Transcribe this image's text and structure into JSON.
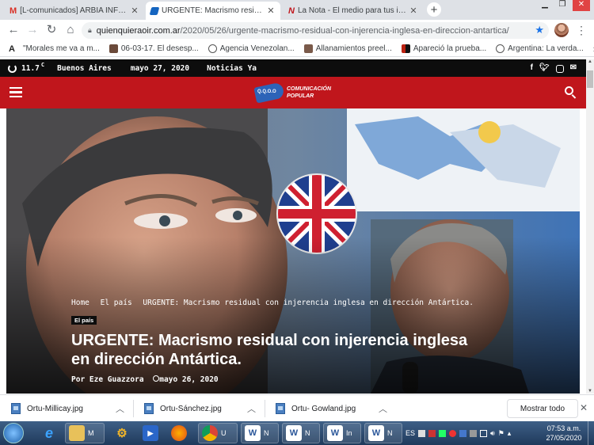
{
  "browser": {
    "tabs": [
      {
        "title": "[L-comunicados] ARBIA INFOR",
        "icon": "gmail-icon"
      },
      {
        "title": "URGENTE: Macrismo residual con",
        "icon": "site-icon",
        "active": true
      },
      {
        "title": "La Nota - El medio para tus ideas",
        "icon": "lanota-icon"
      }
    ],
    "new_tab": "+",
    "url_host": "quienquieraoir.com.ar",
    "url_path": "/2020/05/26/urgente-macrismo-residual-con-injerencia-inglesa-en-direccion-antartica/",
    "bookmarks": [
      {
        "label": "\"Morales me va a m...",
        "color": "#222"
      },
      {
        "label": "06-03-17. El desesp...",
        "color": "#6b4a3a"
      },
      {
        "label": "Agencia Venezolan...",
        "color": "#555"
      },
      {
        "label": "Allanamientos preel...",
        "color": "#7a5a4a"
      },
      {
        "label": "Apareció la prueba...",
        "color": "#b21"
      },
      {
        "label": "Argentina: La verda...",
        "color": "#555"
      }
    ],
    "bookmarks_more": "»"
  },
  "site": {
    "temperature": "11.7",
    "temp_unit": "C",
    "city": "Buenos Aires",
    "date": "mayo 27, 2020",
    "news_link": "Noticias Ya",
    "logo_text_1": "COMUNICACIÓN",
    "logo_text_2": "POPULAR",
    "logo_badge": "Q.Q.O.O",
    "breadcrumb": [
      "Home",
      "El país",
      "URGENTE: Macrismo residual con injerencia inglesa en dirección Antártica."
    ],
    "category": "El país",
    "title_line1": "URGENTE: Macrismo residual con injerencia inglesa",
    "title_line2": "en dirección Antártica.",
    "author_prefix": "Por",
    "author": "Eze Guazzora",
    "post_date": "mayo 26, 2020",
    "social": [
      "facebook-icon",
      "twitter-icon",
      "instagram-icon",
      "mail-icon"
    ]
  },
  "downloads": {
    "items": [
      "Ortu-Millicay.jpg",
      "Ortu-Sánchez.jpg",
      "Ortu- Gowland.jpg"
    ],
    "show_all": "Mostrar todo"
  },
  "taskbar": {
    "items": [
      {
        "label": "M",
        "icon": "folder-icon"
      },
      {
        "label": "U",
        "icon": "chrome-icon"
      },
      {
        "label": "N",
        "icon": "word-icon"
      },
      {
        "label": "N",
        "icon": "word-icon"
      },
      {
        "label": "In",
        "icon": "word-icon"
      },
      {
        "label": "N",
        "icon": "word-icon"
      }
    ],
    "lang": "ES",
    "time": "07:53 a.m.",
    "date": "27/05/2020"
  }
}
